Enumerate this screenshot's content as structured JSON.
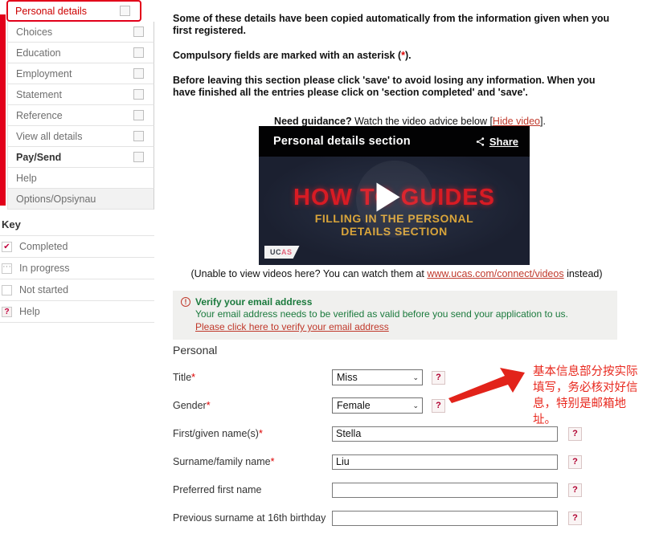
{
  "sidebar": {
    "items": [
      {
        "label": "Personal details",
        "state": "highlight",
        "checkbox": true
      },
      {
        "label": "Choices",
        "state": "normal",
        "checkbox": true
      },
      {
        "label": "Education",
        "state": "normal",
        "checkbox": true
      },
      {
        "label": "Employment",
        "state": "normal",
        "checkbox": true
      },
      {
        "label": "Statement",
        "state": "normal",
        "checkbox": true
      },
      {
        "label": "Reference",
        "state": "normal",
        "checkbox": true
      },
      {
        "label": "View all details",
        "state": "normal",
        "checkbox": true
      },
      {
        "label": "Pay/Send",
        "state": "bold",
        "checkbox": true
      },
      {
        "label": "Help",
        "state": "normal",
        "checkbox": false
      },
      {
        "label": "Options/Opsiynau",
        "state": "shaded",
        "checkbox": false
      }
    ]
  },
  "key": {
    "title": "Key",
    "rows": [
      {
        "label": "Completed",
        "glyph": "✔",
        "kind": "tick"
      },
      {
        "label": "In progress",
        "glyph": "···",
        "kind": "dots"
      },
      {
        "label": "Not started",
        "glyph": "",
        "kind": "blank"
      },
      {
        "label": "Help",
        "glyph": "?",
        "kind": "help"
      }
    ]
  },
  "main": {
    "paragraph_1": "Some of these details have been copied automatically from the information given when you first registered.",
    "paragraph_2_pre": "Compulsory fields are marked with an asterisk (",
    "paragraph_2_ast": "*",
    "paragraph_2_post": ").",
    "paragraph_3": "Before leaving this section please click 'save' to avoid losing any information. When you have finished all the entries please click on 'section completed' and 'save'.",
    "guidance_bold": "Need guidance?",
    "guidance_text": " Watch the video advice below [",
    "guidance_link": "Hide video",
    "guidance_tail": "].",
    "below_video_pre": "(Unable to view videos here? You can watch them at ",
    "below_video_link": "www.ucas.com/connect/videos",
    "below_video_post": " instead)"
  },
  "video": {
    "title": "Personal details section",
    "share_label": "Share",
    "hero_line_1": "HOW TO GUIDES",
    "hero_line_2": "FILLING IN THE PERSONAL",
    "hero_line_3": "DETAILS SECTION",
    "logo_u": "UC",
    "logo_as": "AS"
  },
  "verify": {
    "heading": "Verify your email address",
    "body": "Your email address needs to be verified as valid before you send your application to us.",
    "link": "Please click here to verify your email address",
    "icon": "!"
  },
  "form": {
    "section_title": "Personal",
    "help_glyph": "?",
    "caret_glyph": "⌄",
    "fields": [
      {
        "label": "Title",
        "required": true,
        "type": "select",
        "value": "Miss"
      },
      {
        "label": "Gender",
        "required": true,
        "type": "select",
        "value": "Female"
      },
      {
        "label": "First/given name(s)",
        "required": true,
        "type": "text",
        "value": "Stella"
      },
      {
        "label": "Surname/family name",
        "required": true,
        "type": "text",
        "value": "Liu"
      },
      {
        "label": "Preferred first name",
        "required": false,
        "type": "text",
        "value": ""
      },
      {
        "label": "Previous surname at 16th birthday",
        "required": false,
        "type": "text",
        "value": ""
      }
    ]
  },
  "annotation": {
    "text": "基本信息部分按实际填写，务必核对好信息，特别是邮箱地址。",
    "color": "#e8281e"
  },
  "colors": {
    "brand_red": "#e2001a",
    "link_red": "#c0392b",
    "verify_green": "#1b7a3d",
    "annotation_red": "#e8281e"
  }
}
